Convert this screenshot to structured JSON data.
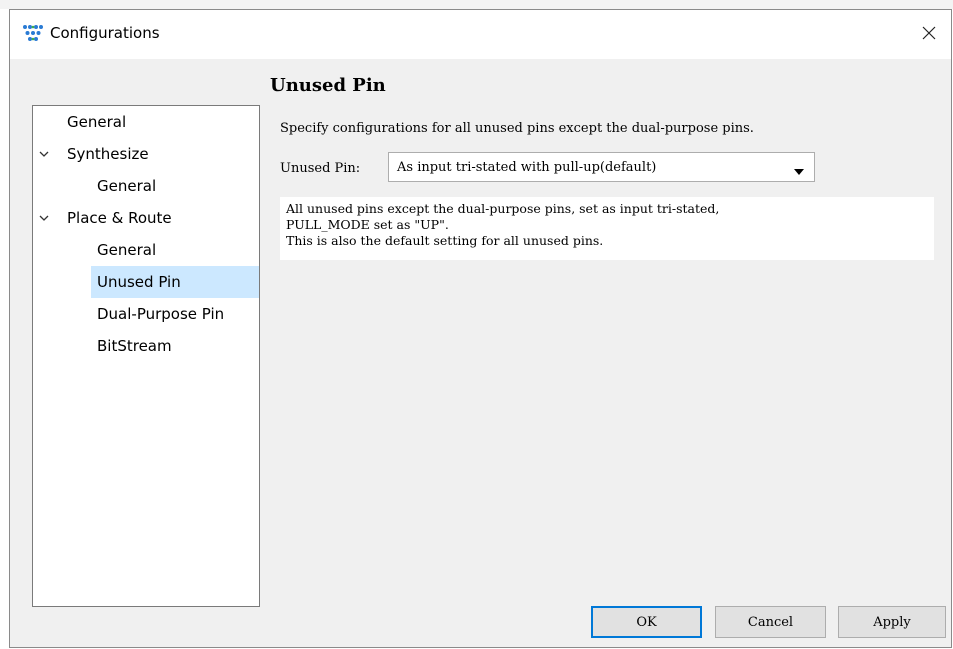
{
  "window": {
    "title": "Configurations",
    "app_icon": "gowin-logo-icon",
    "close_icon": "close-icon"
  },
  "nav": {
    "items": [
      {
        "label": "General",
        "level": 0,
        "expandable": false,
        "selected": false
      },
      {
        "label": "Synthesize",
        "level": 0,
        "expandable": true,
        "expanded": true,
        "selected": false
      },
      {
        "label": "General",
        "level": 1,
        "expandable": false,
        "selected": false
      },
      {
        "label": "Place & Route",
        "level": 0,
        "expandable": true,
        "expanded": true,
        "selected": false
      },
      {
        "label": "General",
        "level": 1,
        "expandable": false,
        "selected": false
      },
      {
        "label": "Unused Pin",
        "level": 1,
        "expandable": false,
        "selected": true
      },
      {
        "label": "Dual-Purpose Pin",
        "level": 1,
        "expandable": false,
        "selected": false
      },
      {
        "label": "BitStream",
        "level": 1,
        "expandable": false,
        "selected": false
      }
    ]
  },
  "content": {
    "section_title": "Unused Pin",
    "description": "Specify configurations for all unused pins except the dual-purpose pins.",
    "unused_pin_label": "Unused Pin:",
    "unused_pin_value": "As input tri-stated with pull-up(default)",
    "info_lines": [
      "All unused pins except the dual-purpose pins, set as input tri-stated,",
      "PULL_MODE set as \"UP\".",
      "This is also the default setting for all unused pins."
    ]
  },
  "buttons": {
    "ok": "OK",
    "cancel": "Cancel",
    "apply": "Apply"
  },
  "colors": {
    "selection": "#cce8ff",
    "focus_border": "#0078d7",
    "dialog_bg": "#f0f0f0"
  }
}
